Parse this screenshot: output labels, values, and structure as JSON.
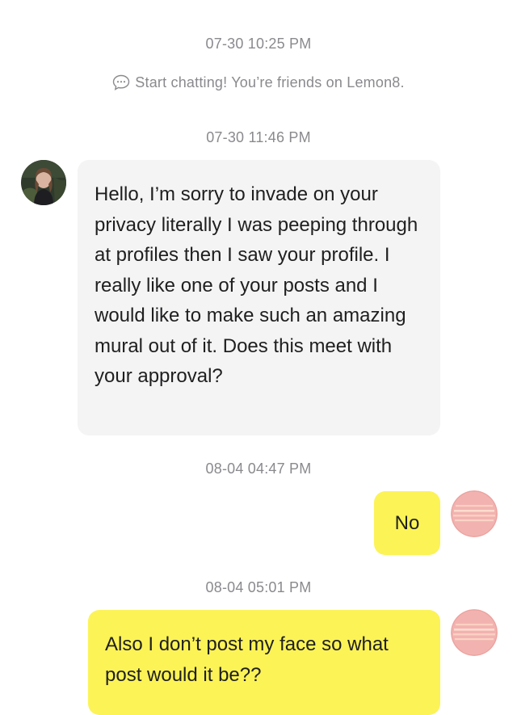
{
  "chat": {
    "timestamps": [
      "07-30 10:25 PM",
      "07-30 11:46 PM",
      "08-04 04:47 PM",
      "08-04 05:01 PM"
    ],
    "system_note": "Start chatting! You’re friends on Lemon8.",
    "system_note_icon": "chat-bubble-icon",
    "messages": [
      {
        "sender": "them",
        "text": "Hello, I’m sorry to invade on your privacy literally I was peeping through at profiles then I saw your profile. I really like one of your posts and I would like to make such an amazing mural out of it. Does this meet with your approval?"
      },
      {
        "sender": "me",
        "text": "No"
      },
      {
        "sender": "me",
        "text": "Also I don’t post my face so what post would it be??"
      }
    ]
  },
  "colors": {
    "background": "#ffffff",
    "incoming_bubble": "#f4f4f5",
    "outgoing_bubble": "#fcf357",
    "timestamp_text": "#8a8a8e",
    "message_text": "#1f1f1f",
    "my_avatar": "#f2b3b0"
  }
}
